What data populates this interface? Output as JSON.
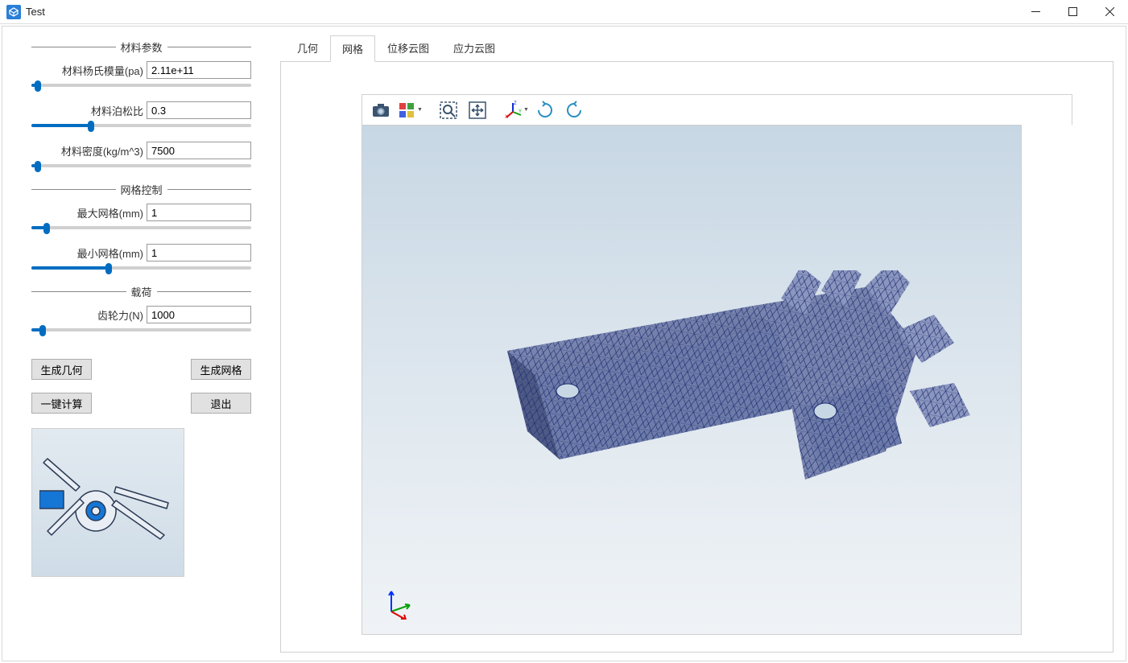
{
  "window": {
    "title": "Test"
  },
  "sidebar": {
    "groups": {
      "material": {
        "header": "材料参数",
        "youngs_modulus": {
          "label": "材料杨氏模量(pa)",
          "value": "2.11e+11",
          "slider_pct": 3
        },
        "poisson_ratio": {
          "label": "材料泊松比",
          "value": "0.3",
          "slider_pct": 27
        },
        "density": {
          "label": "材料密度(kg/m^3)",
          "value": "7500",
          "slider_pct": 3
        }
      },
      "mesh": {
        "header": "网格控制",
        "max_mesh": {
          "label": "最大网格(mm)",
          "value": "1",
          "slider_pct": 7
        },
        "min_mesh": {
          "label": "最小网格(mm)",
          "value": "1",
          "slider_pct": 35
        }
      },
      "load": {
        "header": "载荷",
        "gear_force": {
          "label": "齿轮力(N)",
          "value": "1000",
          "slider_pct": 5
        }
      }
    },
    "buttons": {
      "generate_geometry": "生成几何",
      "generate_mesh": "生成网格",
      "one_click_calc": "一键计算",
      "exit": "退出"
    }
  },
  "tabs": {
    "items": [
      {
        "label": "几何"
      },
      {
        "label": "网格"
      },
      {
        "label": "位移云图"
      },
      {
        "label": "应力云图"
      }
    ],
    "active_index": 1
  },
  "toolbar_icons": {
    "camera": "camera-icon",
    "grid_options": "grid-options-icon",
    "zoom_area": "zoom-area-icon",
    "fit_extents": "fit-extents-icon",
    "orientation_axes": "orientation-axes-icon",
    "rotate_plus_x": "rotate-clockwise-icon",
    "rotate_minus_x": "rotate-counterclockwise-icon"
  },
  "viewport": {
    "bg_start": "#c7d7e4",
    "bg_end": "#eff3f6",
    "mesh_edge_color": "#1a2a6e",
    "mesh_face_color": "#6d7ba9",
    "triad": {
      "x": "red",
      "y": "green",
      "z": "blue"
    }
  }
}
